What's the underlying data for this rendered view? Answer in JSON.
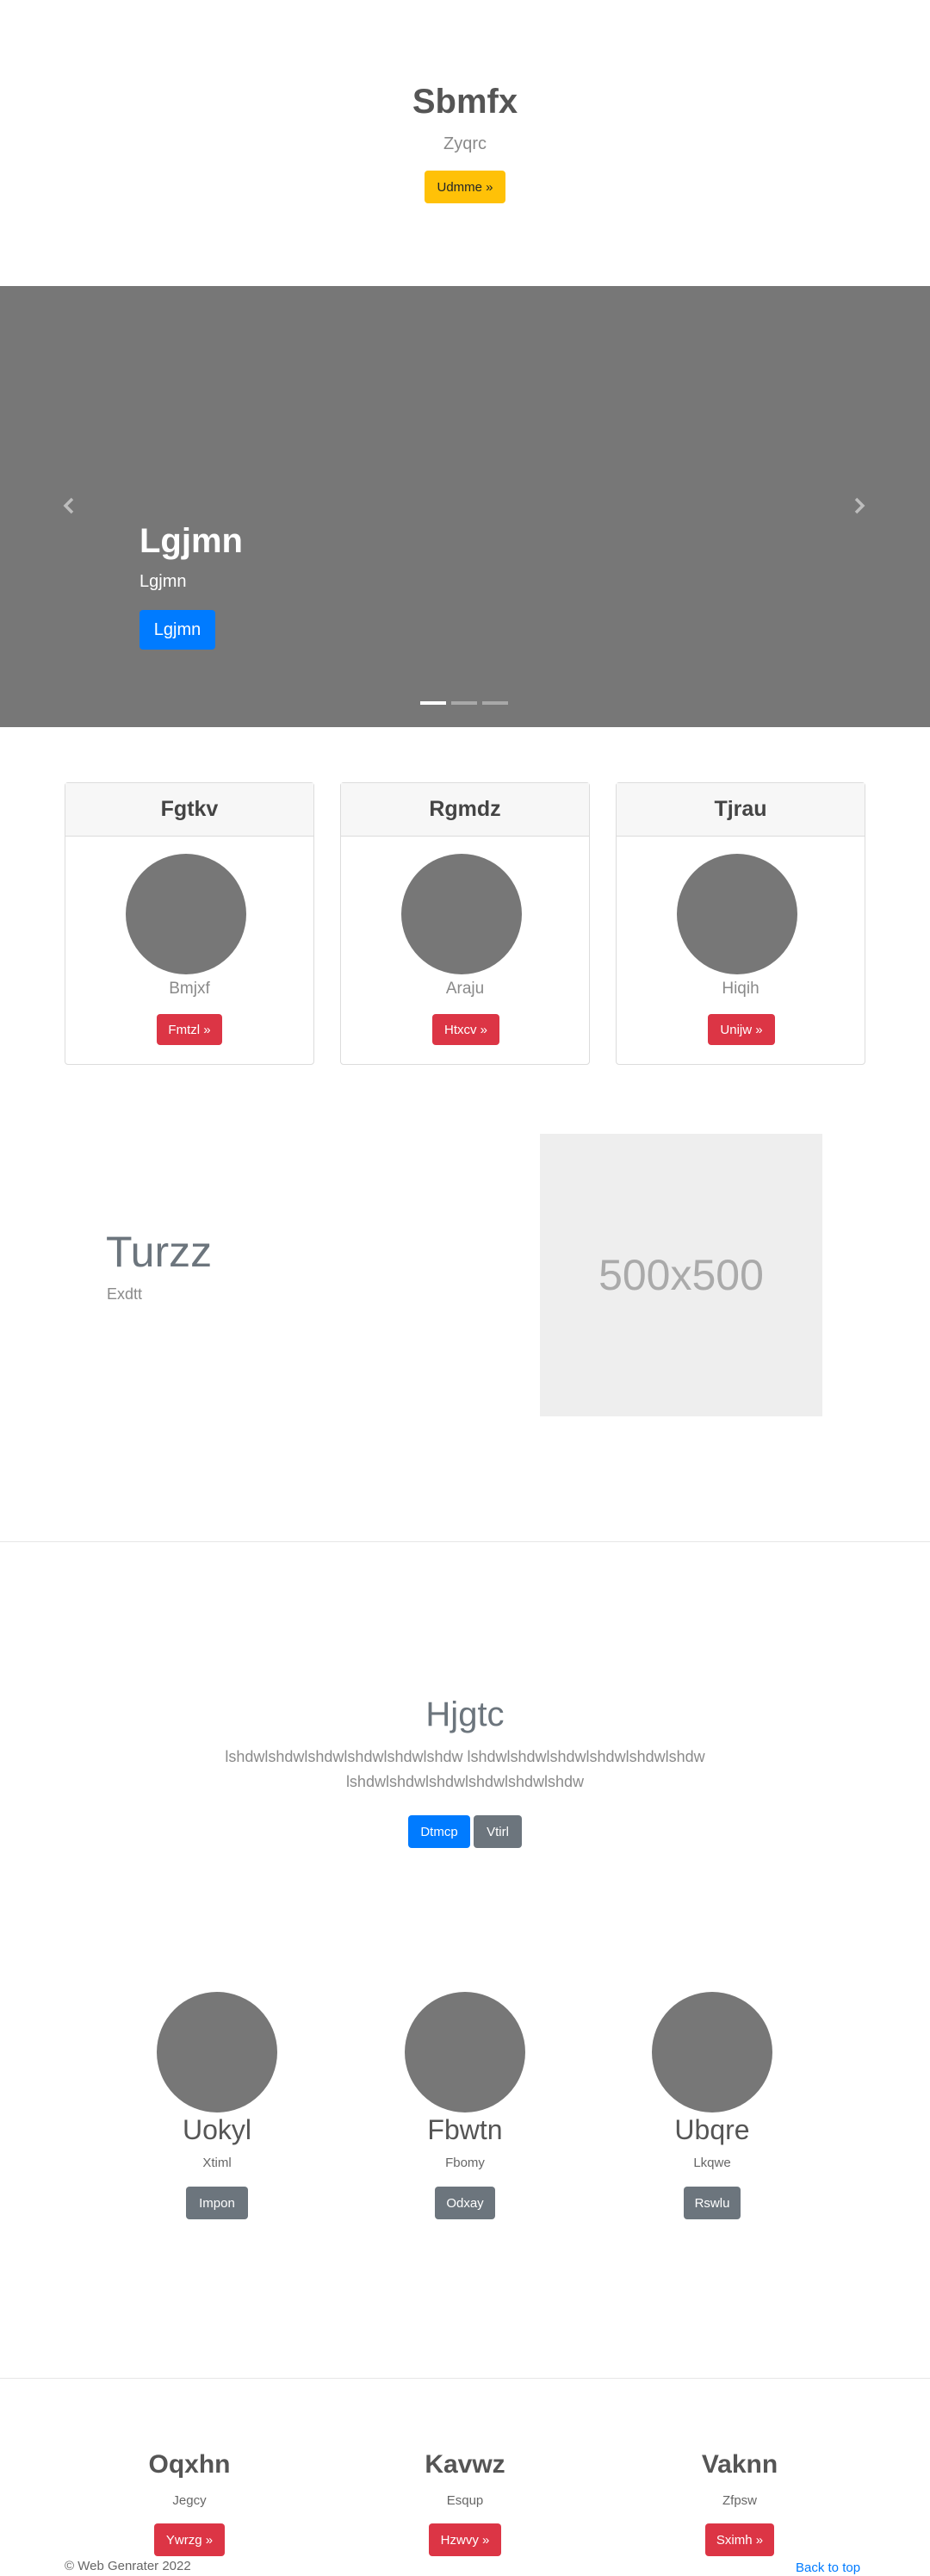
{
  "hero": {
    "title": "Sbmfx",
    "subtitle": "Zyqrc",
    "button": "Udmme »"
  },
  "carousel": {
    "caption_title": "Lgjmn",
    "caption_text": "Lgjmn",
    "caption_button": "Lgjmn",
    "indicator_count": 3,
    "active_indicator": 1,
    "prev_icon": "chevron-left-icon",
    "next_icon": "chevron-right-icon"
  },
  "cards": [
    {
      "header": "Fgtkv",
      "text": "Bmjxf",
      "button": "Fmtzl »"
    },
    {
      "header": "Rgmdz",
      "text": "Araju",
      "button": "Htxcv »"
    },
    {
      "header": "Tjrau",
      "text": "Hiqih",
      "button": "Unijw »"
    }
  ],
  "feature": {
    "title": "Turzz",
    "subtitle": "Exdtt",
    "placeholder_label": "500x500"
  },
  "jumbotron": {
    "title": "Hjgtc",
    "line1": "lshdwlshdwlshdwlshdwlshdwlshdw lshdwlshdwlshdwlshdwlshdwlshdw",
    "line2": "lshdwlshdwlshdwlshdwlshdwlshdw",
    "primary_button": "Dtmcp",
    "secondary_button": "Vtirl"
  },
  "team": [
    {
      "name": "Uokyl",
      "role": "Xtiml",
      "button": "Impon"
    },
    {
      "name": "Fbwtn",
      "role": "Fbomy",
      "button": "Odxay"
    },
    {
      "name": "Ubqre",
      "role": "Lkqwe",
      "button": "Rswlu"
    }
  ],
  "footer_columns": [
    {
      "title": "Oqxhn",
      "text": "Jegcy",
      "button": "Ywrzg »"
    },
    {
      "title": "Kavwz",
      "text": "Esqup",
      "button": "Hzwvy »"
    },
    {
      "title": "Vaknn",
      "text": "Zfpsw",
      "button": "Sximh »"
    }
  ],
  "footer": {
    "copyright": "© Web Genrater 2022",
    "back_to_top": "Back to top"
  },
  "colors": {
    "warning": "#ffc107",
    "danger": "#dc3545",
    "primary": "#007bff",
    "secondary": "#6c757d",
    "placeholder_gray": "#777777",
    "link": "#007bff"
  }
}
